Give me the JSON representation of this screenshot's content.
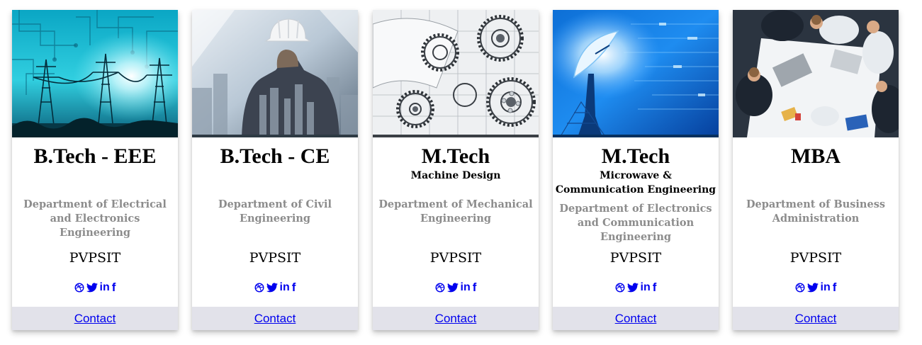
{
  "cards": [
    {
      "image_icon": "power-lines-circuit-image",
      "title": "B.Tech - EEE",
      "subtitle": "",
      "department": "Department of Electrical and Electronics Engineering",
      "org": "PVPSIT",
      "social": {
        "dribbble": "dribbble-icon",
        "twitter": "twitter-icon",
        "linkedin": "in",
        "facebook": "f"
      },
      "contact_label": "Contact"
    },
    {
      "image_icon": "engineer-hardhat-city-image",
      "title": "B.Tech - CE",
      "subtitle": "",
      "department": "Department of Civil Engineering",
      "org": "PVPSIT",
      "social": {
        "dribbble": "dribbble-icon",
        "twitter": "twitter-icon",
        "linkedin": "in",
        "facebook": "f"
      },
      "contact_label": "Contact"
    },
    {
      "image_icon": "machine-gears-drawing-image",
      "title": "M.Tech",
      "subtitle": "Machine Design",
      "department": "Department of Mechanical Engineering",
      "org": "PVPSIT",
      "social": {
        "dribbble": "dribbble-icon",
        "twitter": "twitter-icon",
        "linkedin": "in",
        "facebook": "f"
      },
      "contact_label": "Contact"
    },
    {
      "image_icon": "satellite-dish-image",
      "title": "M.Tech",
      "subtitle": "Microwave &  Communication Engineering",
      "department": "Department of Electronics and Communication Engineering",
      "org": "PVPSIT",
      "social": {
        "dribbble": "dribbble-icon",
        "twitter": "twitter-icon",
        "linkedin": "in",
        "facebook": "f"
      },
      "contact_label": "Contact"
    },
    {
      "image_icon": "business-meeting-image",
      "title": "MBA",
      "subtitle": "",
      "department": "Department of Business Administration",
      "org": "PVPSIT",
      "social": {
        "dribbble": "dribbble-icon",
        "twitter": "twitter-icon",
        "linkedin": "in",
        "facebook": "f"
      },
      "contact_label": "Contact"
    }
  ],
  "colors": {
    "link": "#0000ee",
    "contact_bar": "#e2e2ea",
    "department_text": "#8c8c8c"
  }
}
